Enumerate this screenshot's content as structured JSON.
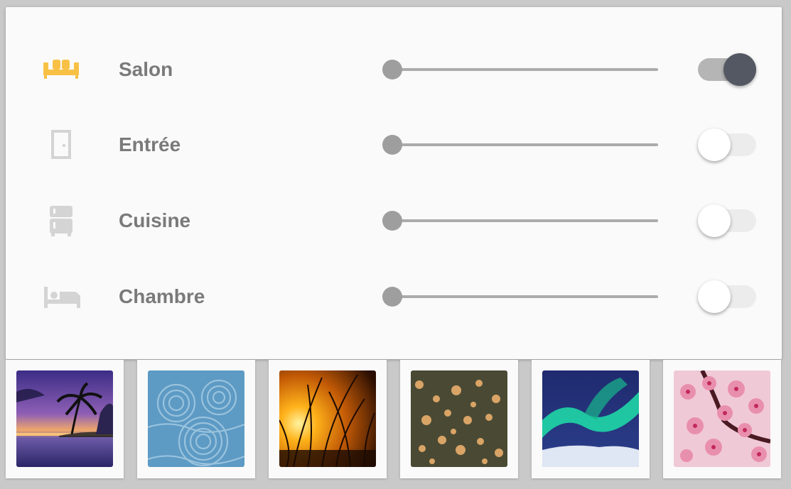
{
  "rooms": [
    {
      "label": "Salon",
      "icon": "sofa-icon",
      "icon_color": "#f8c146",
      "dimmer_level": 0,
      "power_on": true
    },
    {
      "label": "Entrée",
      "icon": "door-icon",
      "icon_color": "#d4d4d4",
      "dimmer_level": 0,
      "power_on": false
    },
    {
      "label": "Cuisine",
      "icon": "fridge-icon",
      "icon_color": "#d4d4d4",
      "dimmer_level": 0,
      "power_on": false
    },
    {
      "label": "Chambre",
      "icon": "bed-icon",
      "icon_color": "#d4d4d4",
      "dimmer_level": 0,
      "power_on": false
    }
  ],
  "wallpapers": [
    {
      "theme": "palm-sunset"
    },
    {
      "theme": "zen-sand"
    },
    {
      "theme": "golden-grass"
    },
    {
      "theme": "bokeh-lights"
    },
    {
      "theme": "aurora"
    },
    {
      "theme": "cherry-blossom"
    }
  ],
  "colors": {
    "toggle_on_knob": "#545862",
    "accent": "#f8c146",
    "label": "#7a7a7a"
  }
}
